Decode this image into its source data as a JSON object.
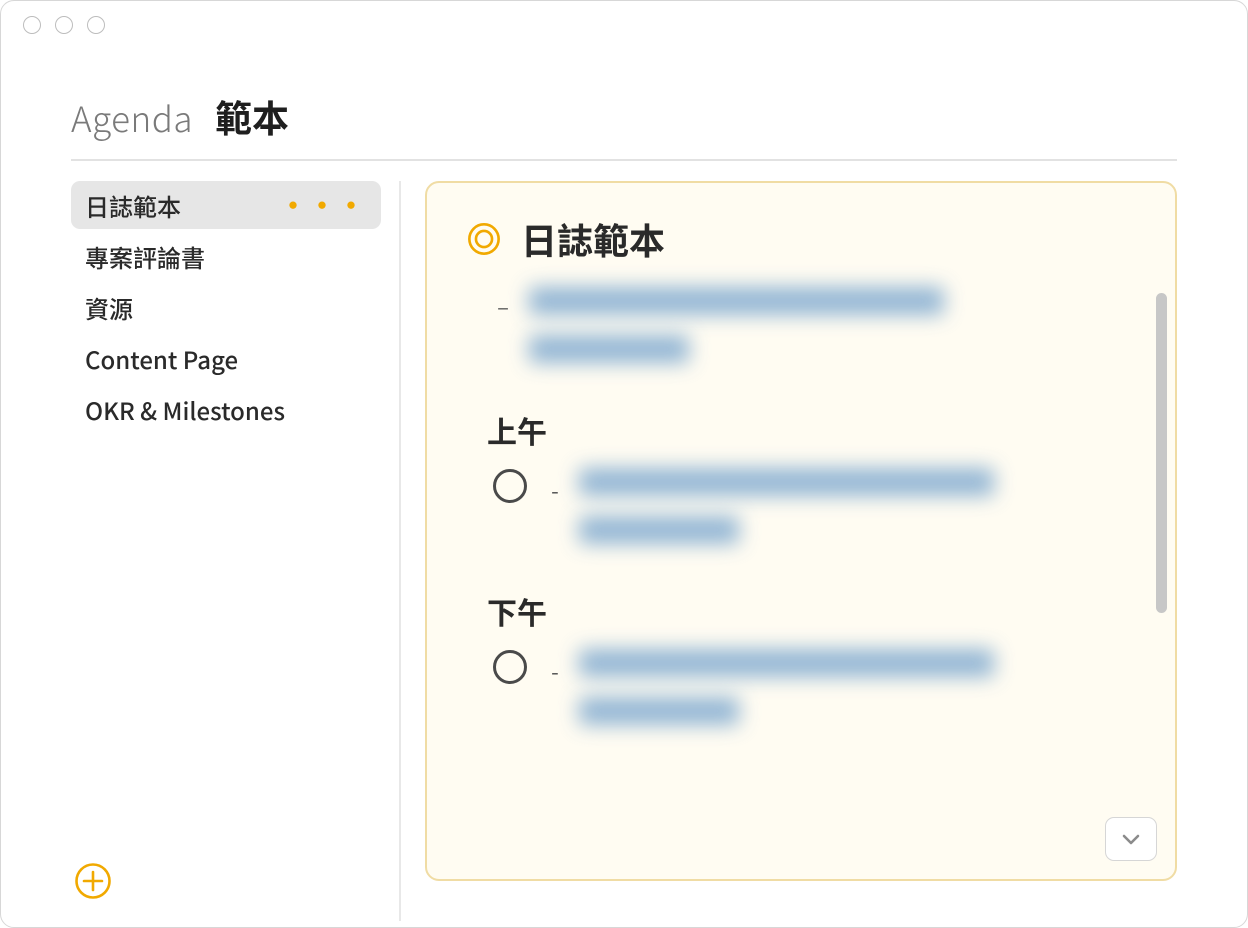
{
  "header": {
    "app_name": "Agenda",
    "section_title": "範本"
  },
  "sidebar": {
    "items": [
      {
        "label": "日誌範本",
        "selected": true
      },
      {
        "label": "專案評論書",
        "selected": false
      },
      {
        "label": "資源",
        "selected": false
      },
      {
        "label": "Content Page",
        "selected": false
      },
      {
        "label": "OKR & Milestones",
        "selected": false
      }
    ],
    "more_indicator": "•••"
  },
  "note": {
    "title": "日誌範本",
    "sections": [
      {
        "heading": "上午"
      },
      {
        "heading": "下午"
      }
    ]
  },
  "colors": {
    "accent": "#f1a900",
    "note_bg": "#fffcf2",
    "note_border": "#f0dca4"
  },
  "icons": {
    "title_icon": "double-circle-icon",
    "add": "plus-circle-icon",
    "more": "ellipsis-icon",
    "expand": "chevron-down-icon",
    "checkbox": "empty-circle-icon"
  }
}
